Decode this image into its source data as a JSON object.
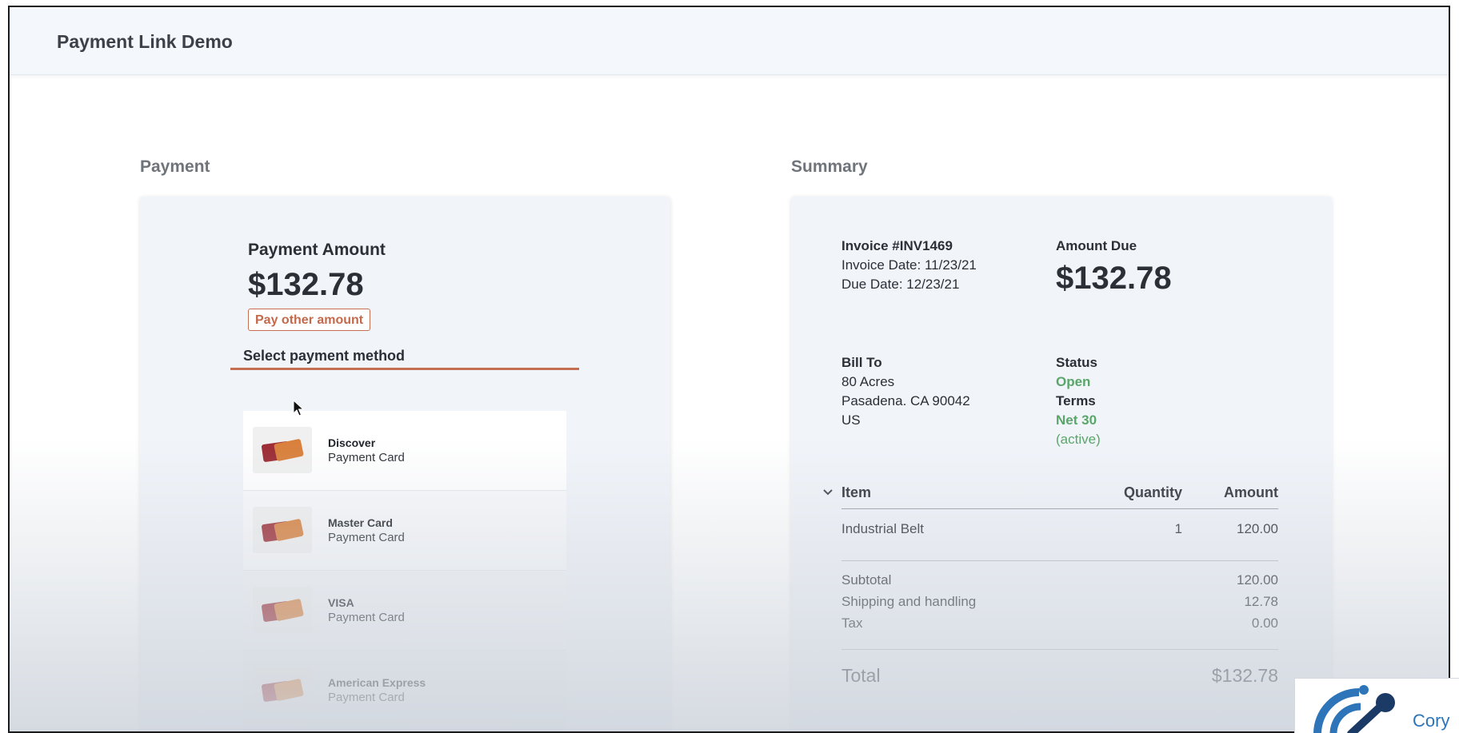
{
  "header": {
    "title": "Payment Link Demo"
  },
  "payment": {
    "section_label": "Payment",
    "amount_label": "Payment Amount",
    "amount_value": "$132.78",
    "pay_other_label": "Pay other amount",
    "method_label": "Select payment method",
    "methods": [
      {
        "name": "Discover",
        "type": "Payment Card"
      },
      {
        "name": "Master Card",
        "type": "Payment Card"
      },
      {
        "name": "VISA",
        "type": "Payment Card"
      },
      {
        "name": "American Express",
        "type": "Payment Card"
      }
    ]
  },
  "summary": {
    "section_label": "Summary",
    "invoice_number": "Invoice #INV1469",
    "invoice_date": "Invoice Date: 11/23/21",
    "due_date": "Due Date: 12/23/21",
    "amount_due_label": "Amount Due",
    "amount_due_value": "$132.78",
    "bill_to_label": "Bill To",
    "address": [
      "80 Acres",
      "Pasadena. CA 90042",
      "US"
    ],
    "status_label": "Status",
    "status_value": "Open",
    "terms_label": "Terms",
    "terms_value": "Net 30",
    "terms_note": "(active)",
    "table": {
      "headers": {
        "item": "Item",
        "quantity": "Quantity",
        "amount": "Amount"
      },
      "rows": [
        {
          "item": "Industrial Belt",
          "quantity": "1",
          "amount": "120.00"
        }
      ]
    },
    "totals": [
      {
        "label": "Subtotal",
        "value": "120.00"
      },
      {
        "label": "Shipping and handling",
        "value": "12.78"
      },
      {
        "label": "Tax",
        "value": "0.00"
      }
    ],
    "total_label": "Total",
    "total_value": "$132.78"
  },
  "watermark": {
    "text": "Cory"
  },
  "colors": {
    "accent": "#c46f52",
    "status_green": "#5aa66a",
    "logo_blue": "#2d74b8",
    "logo_navy": "#1b3a66"
  }
}
